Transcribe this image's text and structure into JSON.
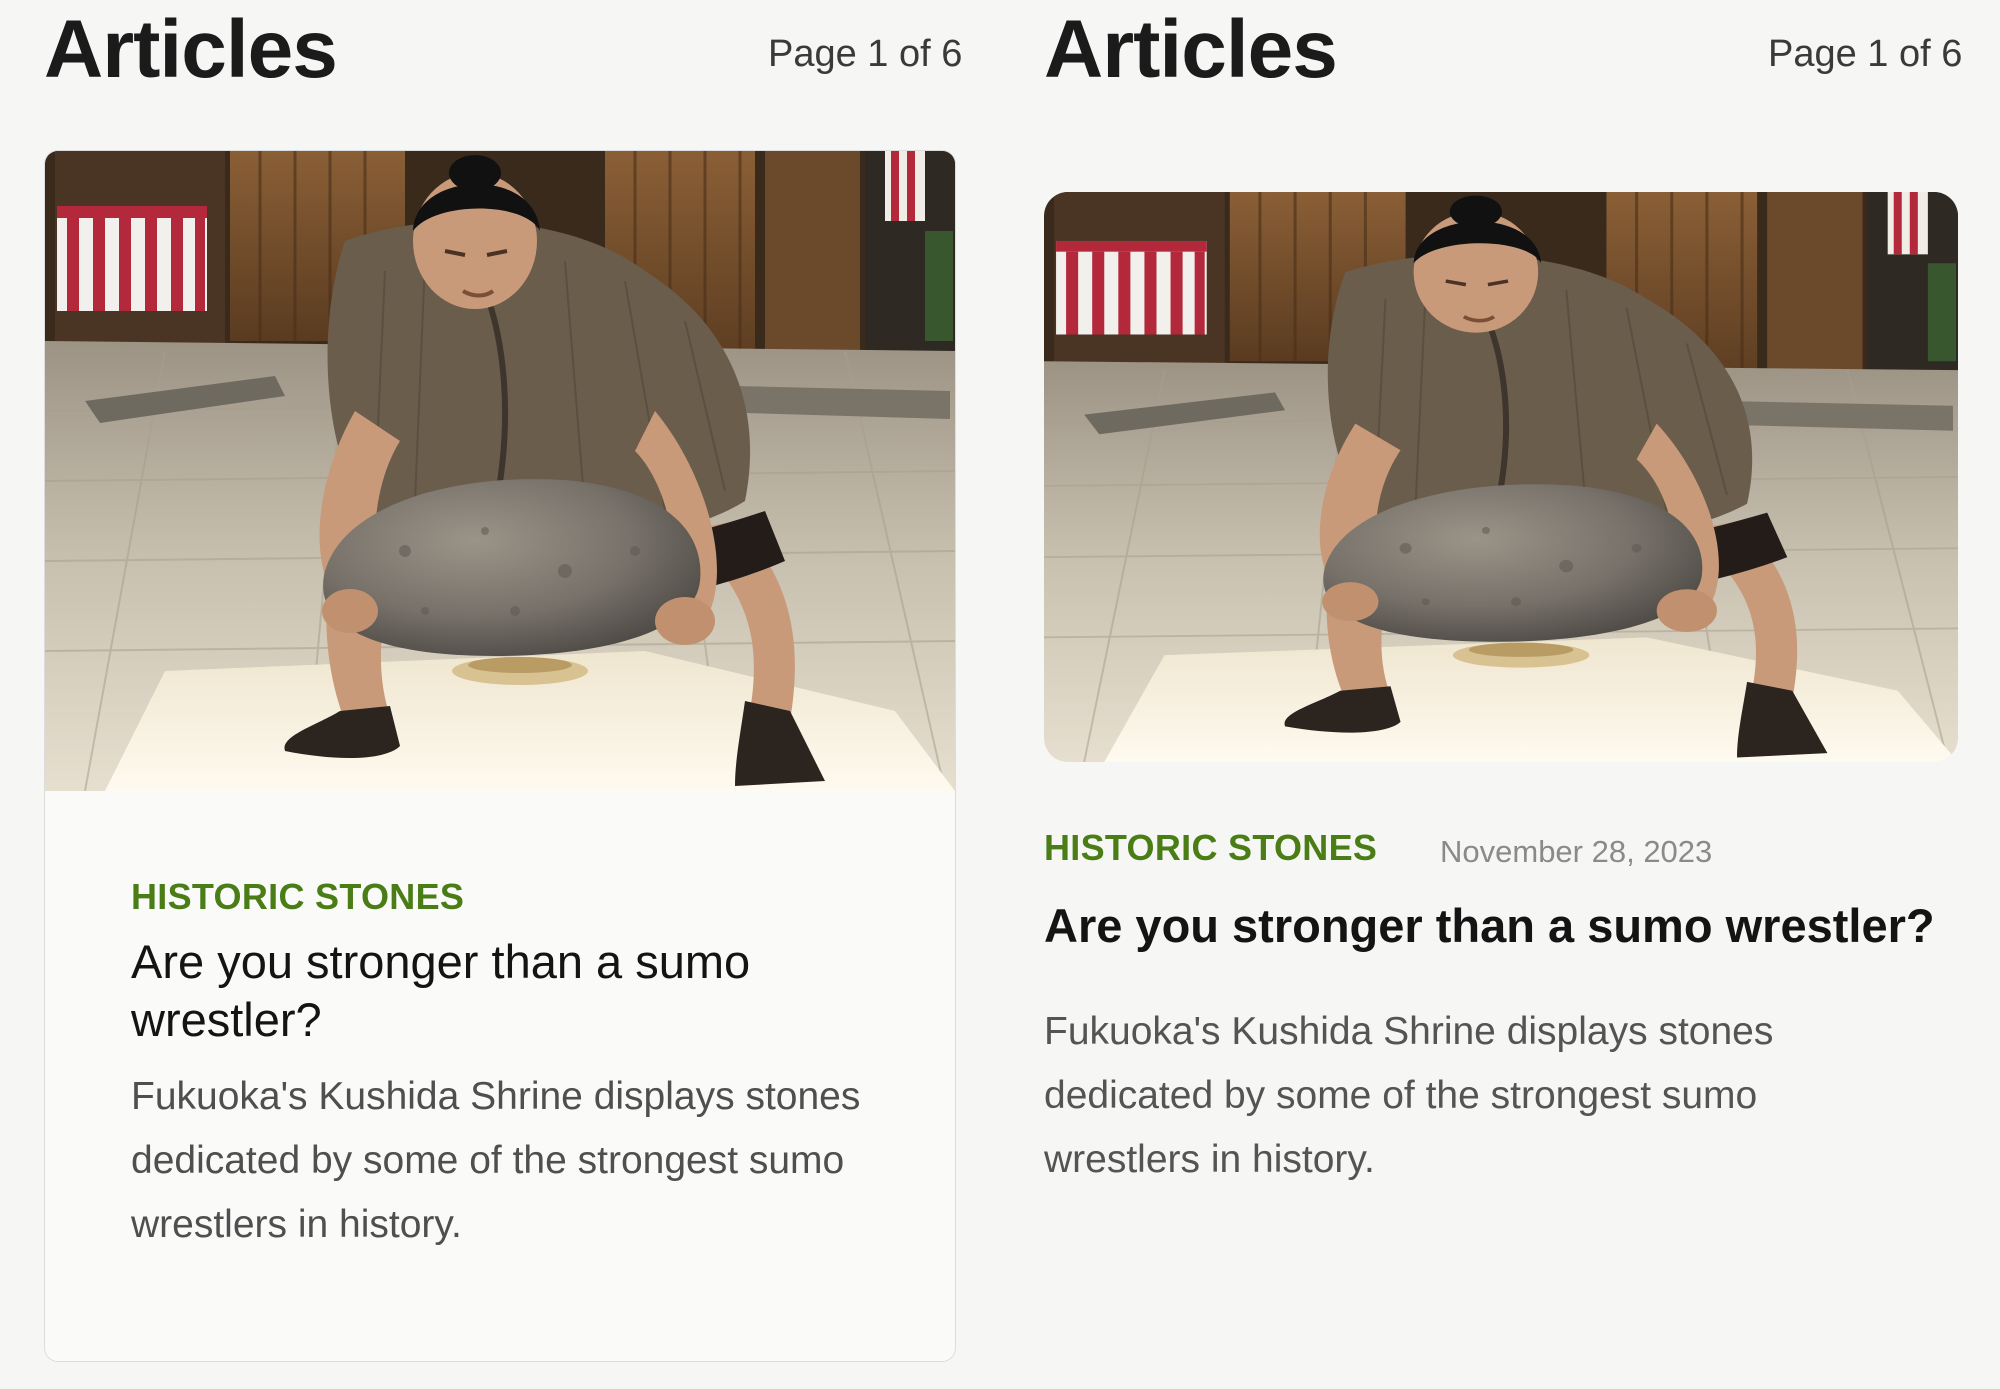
{
  "left_pane": {
    "title": "Articles",
    "page_indicator": "Page 1 of 6",
    "card": {
      "category": "HISTORIC STONES",
      "headline": "Are you stronger than a sumo wrestler?",
      "summary": "Fukuoka's Kushida Shrine displays stones dedicated by some of the strongest sumo wrestlers in history.",
      "image_alt": "Sumo wrestler lifting a large stone at a shrine"
    }
  },
  "right_pane": {
    "title": "Articles",
    "page_indicator": "Page 1 of 6",
    "article": {
      "category": "HISTORIC STONES",
      "date": "November 28, 2023",
      "headline": "Are you stronger than a sumo wrestler?",
      "summary": "Fukuoka's Kushida Shrine displays stones dedicated by some of the strongest sumo wrestlers in history.",
      "image_alt": "Sumo wrestler lifting a large stone at a shrine"
    }
  },
  "colors": {
    "background": "#f6f6f5",
    "category_green": "#4a7d16",
    "headline_text": "#141414",
    "summary_text": "#4f4f4f",
    "date_text": "#8a8a8a"
  }
}
